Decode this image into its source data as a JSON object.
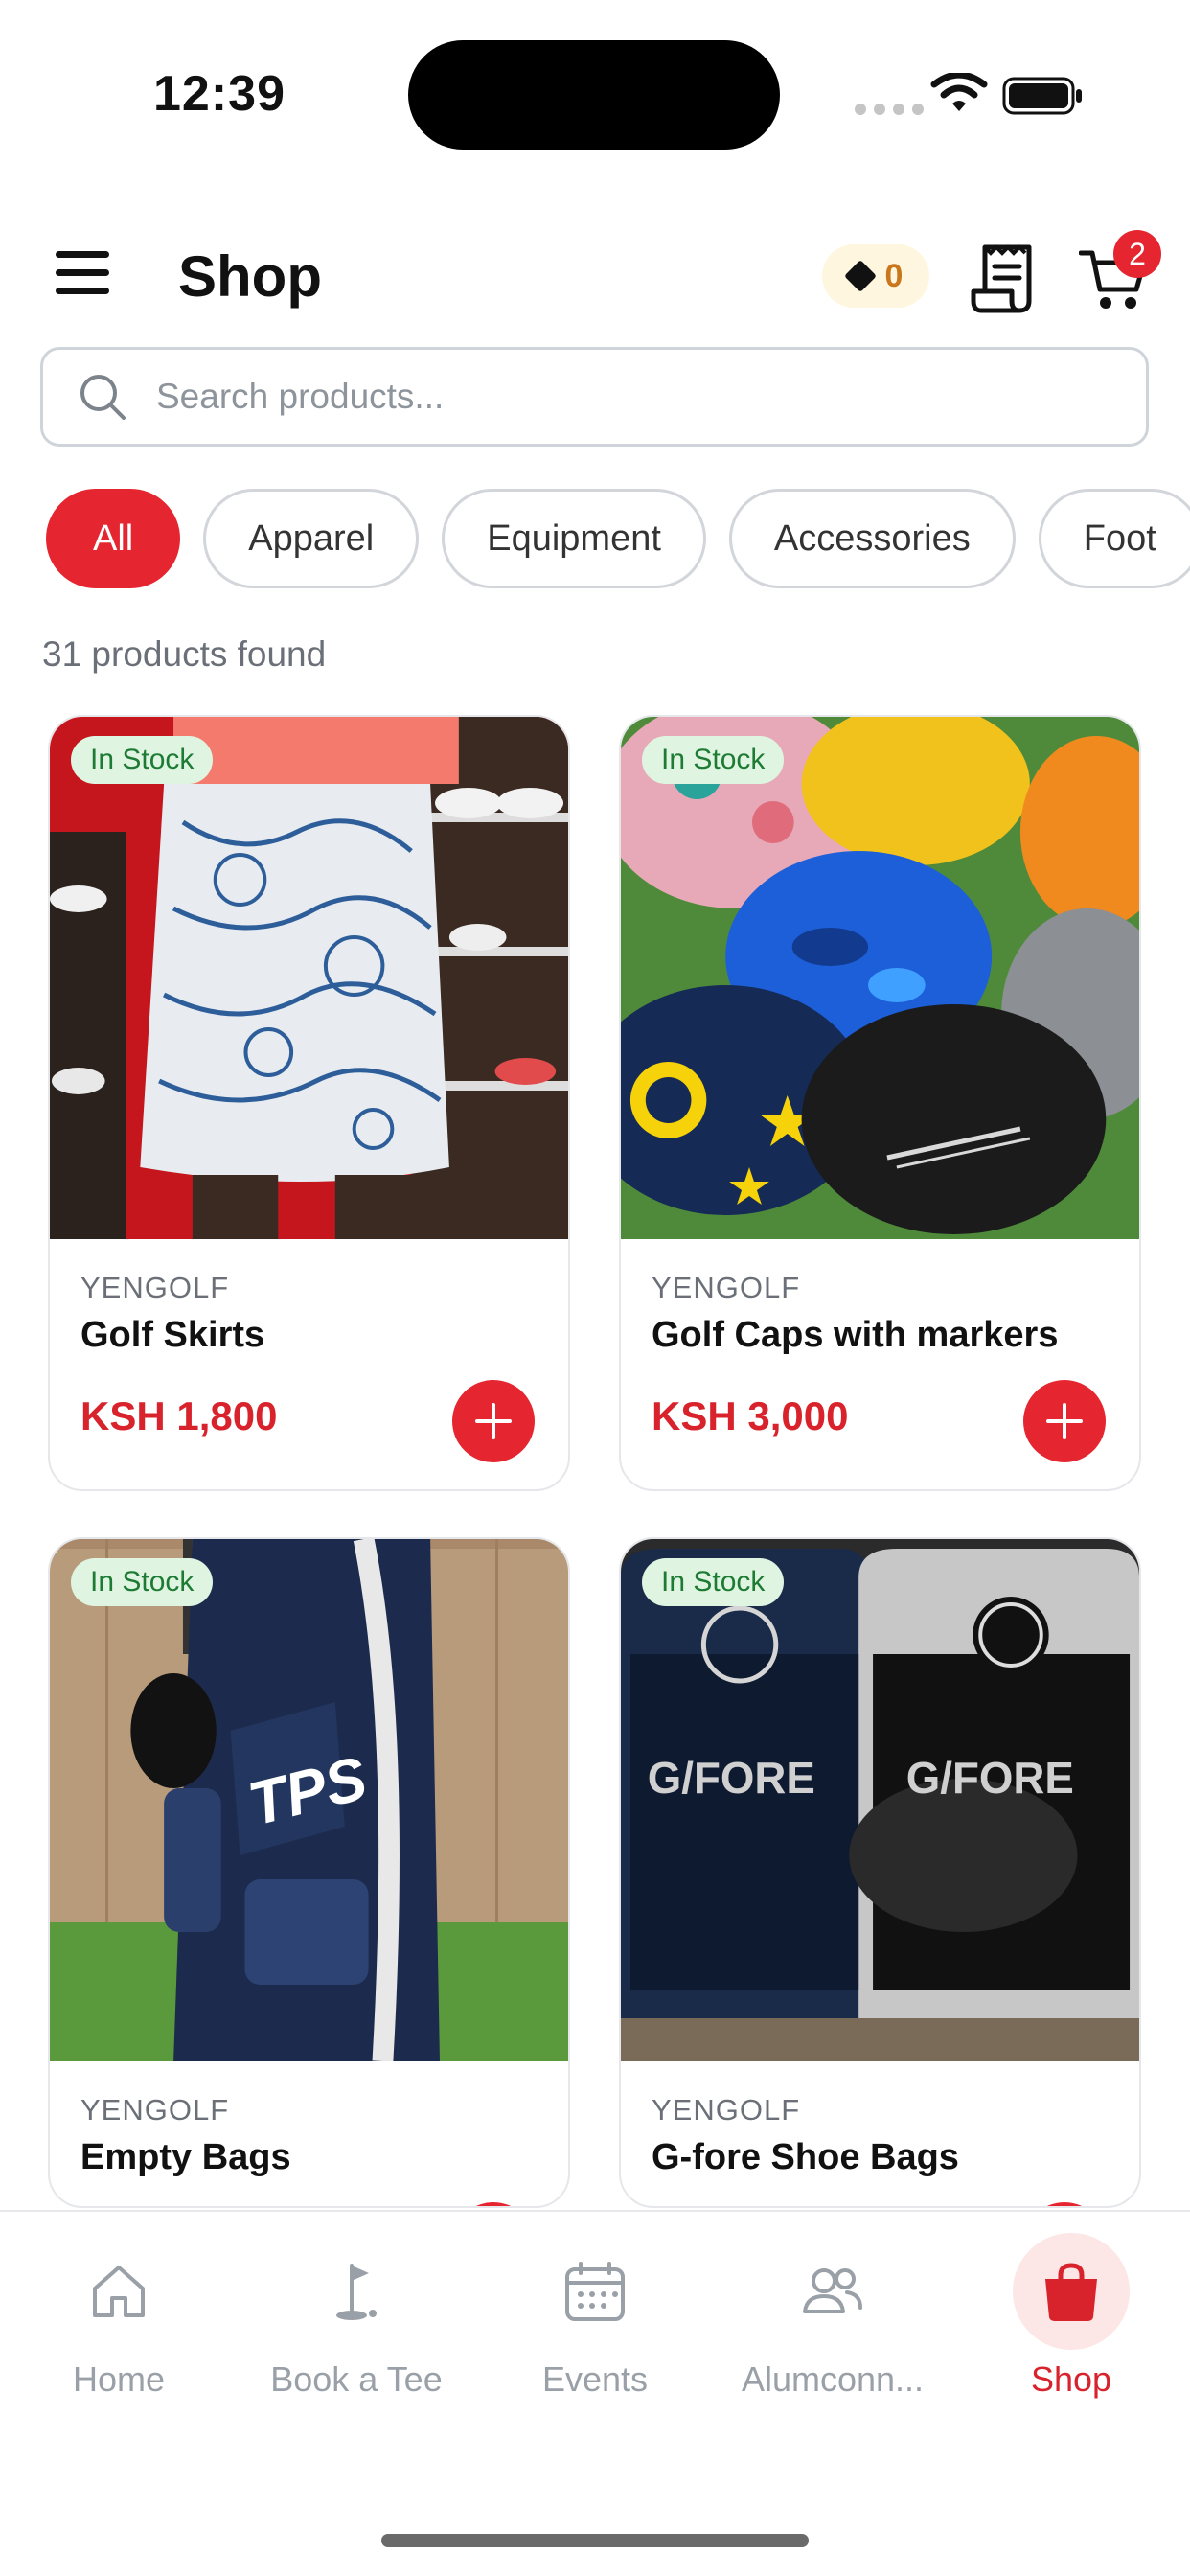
{
  "status_bar": {
    "time": "12:39"
  },
  "header": {
    "title": "Shop",
    "points": "0",
    "cart_count": "2"
  },
  "search": {
    "placeholder": "Search products..."
  },
  "filters": [
    "All",
    "Apparel",
    "Equipment",
    "Accessories",
    "Foot"
  ],
  "active_filter": "All",
  "result_count": "31 products found",
  "products": [
    {
      "stock": "In Stock",
      "brand": "YENGOLF",
      "name": "Golf Skirts",
      "price": "KSH 1,800"
    },
    {
      "stock": "In Stock",
      "brand": "YENGOLF",
      "name": "Golf Caps with markers",
      "price": "KSH 3,000"
    },
    {
      "stock": "In Stock",
      "brand": "YENGOLF",
      "name": "Empty Bags",
      "price": ""
    },
    {
      "stock": "In Stock",
      "brand": "YENGOLF",
      "name": "G-fore Shoe Bags",
      "price": ""
    }
  ],
  "product_image_text": {
    "bag_brand": "TPS",
    "shoe_bag_brand": "G/FORE"
  },
  "nav": [
    {
      "label": "Home",
      "icon": "home-icon"
    },
    {
      "label": "Book a Tee",
      "icon": "golf-flag-icon"
    },
    {
      "label": "Events",
      "icon": "calendar-icon"
    },
    {
      "label": "Alumconn...",
      "icon": "people-icon"
    },
    {
      "label": "Shop",
      "icon": "shopping-bag-icon",
      "active": true
    }
  ],
  "colors": {
    "accent": "#e5252f",
    "price": "#d8232c",
    "stock_bg": "#dff5e2",
    "stock_text": "#1e7b34",
    "points_bg": "#fff6df"
  }
}
